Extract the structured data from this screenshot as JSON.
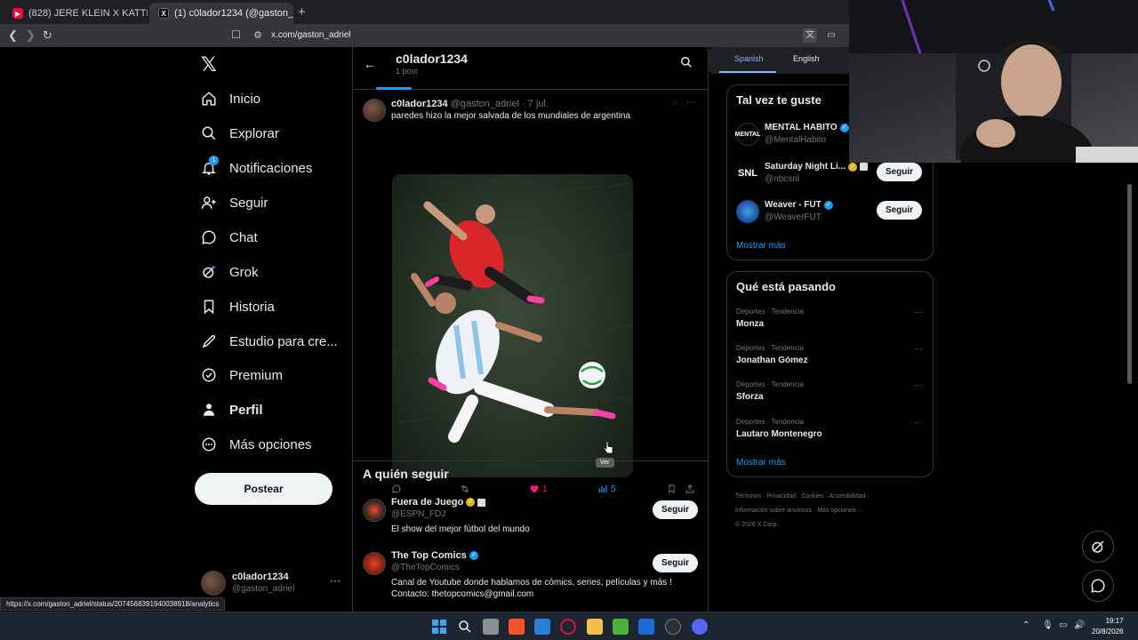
{
  "browser": {
    "tabs": [
      {
        "title": "(828) JERE KLEIN X KATTEYES - TODO",
        "icon": "youtube-icon"
      },
      {
        "title": "(1) c0lador1234 (@gaston_adriel",
        "icon": "x-icon"
      }
    ],
    "url": "x.com/gaston_adriel",
    "status_url": "https://x.com/gaston_adriel/status/2074568391940038918/analytics"
  },
  "nav": {
    "items": [
      {
        "label": "Inicio",
        "icon": "home-icon"
      },
      {
        "label": "Explorar",
        "icon": "search-icon"
      },
      {
        "label": "Notificaciones",
        "icon": "bell-icon",
        "badge": "1"
      },
      {
        "label": "Seguir",
        "icon": "follow-icon"
      },
      {
        "label": "Chat",
        "icon": "chat-icon"
      },
      {
        "label": "Grok",
        "icon": "grok-icon"
      },
      {
        "label": "Historia",
        "icon": "bookmark-icon"
      },
      {
        "label": "Estudio para cre...",
        "icon": "rocket-icon"
      },
      {
        "label": "Premium",
        "icon": "premium-icon"
      },
      {
        "label": "Perfil",
        "icon": "person-icon"
      },
      {
        "label": "Más opciones",
        "icon": "more-icon"
      }
    ],
    "post_button": "Postear",
    "account": {
      "name": "c0lador1234",
      "handle": "@gaston_adriel",
      "more": "···"
    }
  },
  "profile": {
    "title": "c0lador1234",
    "subtitle": "1 post"
  },
  "post": {
    "author": "c0lador1234",
    "meta": "@gaston_adriel · 7 jul.",
    "text": "paredes hizo la mejor salvada de los mundiales de argentina",
    "likes": "1",
    "views": "5",
    "tooltip": "Ver"
  },
  "who_to_follow": {
    "title": "A quién seguir",
    "follow_label": "Seguir",
    "accounts": [
      {
        "name": "Fuera de Juego",
        "handle": "@ESPN_FDJ",
        "bio": "El show del mejor fútbol del mundo"
      },
      {
        "name": "The Top Comics",
        "handle": "@TheTopComics",
        "bio": "Canal de Youtube donde hablamos de cómics, series, películas y más ! Contacto: thetopcomics@gmail.com"
      }
    ]
  },
  "translate_bar": {
    "tabs": [
      "Spanish",
      "English"
    ]
  },
  "suggestions": {
    "title": "Tal vez te guste",
    "follow_label": "Seguir",
    "more": "Mostrar más",
    "accounts": [
      {
        "name": "MENTAL HABITO",
        "handle": "@MentalHabito",
        "logo": "MENTAL"
      },
      {
        "name": "Saturday Night Li...",
        "handle": "@nbcsnl",
        "logo": "SNL"
      },
      {
        "name": "Weaver - FUT",
        "handle": "@WeaverFUT",
        "logo": ""
      }
    ]
  },
  "trends": {
    "title": "Qué está pasando",
    "more": "Mostrar más",
    "items": [
      {
        "category": "Deportes · Tendencia",
        "topic": "Monza"
      },
      {
        "category": "Deportes · Tendencia",
        "topic": "Jonathan Gómez"
      },
      {
        "category": "Deportes · Tendencia",
        "topic": "Sforza"
      },
      {
        "category": "Deportes · Tendencia",
        "topic": "Lautaro Montenegro"
      }
    ]
  },
  "footer": {
    "line1": "Términos · Privacidad · Cookies · Accesibilidad ·",
    "line2": "Información sobre anuncios · Más opciones ···",
    "line3": "© 2026 X Corp."
  },
  "clock": {
    "time": "19:17",
    "date": "20/8/2026"
  },
  "colors": {
    "accent": "#1d9bf0",
    "like": "#f91880",
    "bg": "#000000"
  }
}
